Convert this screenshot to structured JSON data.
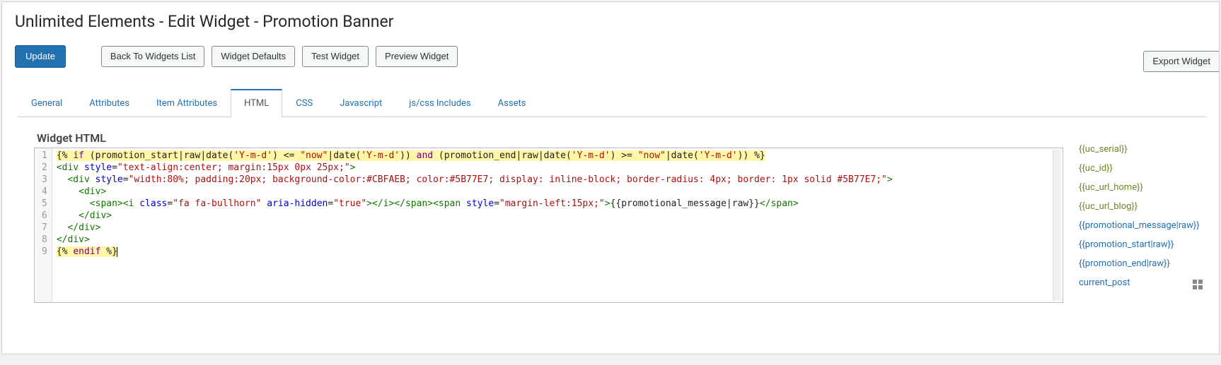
{
  "page": {
    "title": "Unlimited Elements - Edit Widget - Promotion Banner"
  },
  "toolbar": {
    "update": "Update",
    "back": "Back To Widgets List",
    "defaults": "Widget Defaults",
    "test": "Test Widget",
    "preview": "Preview Widget",
    "export": "Export Widget"
  },
  "tabs": [
    {
      "id": "general",
      "label": "General",
      "active": false
    },
    {
      "id": "attributes",
      "label": "Attributes",
      "active": false
    },
    {
      "id": "item-attributes",
      "label": "Item Attributes",
      "active": false
    },
    {
      "id": "html",
      "label": "HTML",
      "active": true
    },
    {
      "id": "css",
      "label": "CSS",
      "active": false
    },
    {
      "id": "js",
      "label": "Javascript",
      "active": false
    },
    {
      "id": "includes",
      "label": "js/css Includes",
      "active": false
    },
    {
      "id": "assets",
      "label": "Assets",
      "active": false
    }
  ],
  "editor": {
    "heading": "Widget HTML",
    "code_lines": [
      {
        "n": 1,
        "hl": true,
        "tokens": [
          {
            "t": "{% ",
            "c": "tok"
          },
          {
            "t": "if",
            "c": "kw"
          },
          {
            "t": " (promotion_start|raw|date(",
            "c": "tok"
          },
          {
            "t": "'Y-m-d'",
            "c": "str"
          },
          {
            "t": ") <= ",
            "c": "tok"
          },
          {
            "t": "\"now\"",
            "c": "str"
          },
          {
            "t": "|date(",
            "c": "tok"
          },
          {
            "t": "'Y-m-d'",
            "c": "str"
          },
          {
            "t": ")) ",
            "c": "tok"
          },
          {
            "t": "and",
            "c": "kw"
          },
          {
            "t": " (promotion_end|raw|date(",
            "c": "tok"
          },
          {
            "t": "'Y-m-d'",
            "c": "str"
          },
          {
            "t": ") >= ",
            "c": "tok"
          },
          {
            "t": "\"now\"",
            "c": "str"
          },
          {
            "t": "|date(",
            "c": "tok"
          },
          {
            "t": "'Y-m-d'",
            "c": "str"
          },
          {
            "t": ")) %}",
            "c": "tok"
          }
        ]
      },
      {
        "n": 2,
        "hl": false,
        "tokens": [
          {
            "t": "<div ",
            "c": "tag"
          },
          {
            "t": "style",
            "c": "attr"
          },
          {
            "t": "=",
            "c": "tok"
          },
          {
            "t": "\"text-align:center; margin:15px 0px 25px;\"",
            "c": "str"
          },
          {
            "t": ">",
            "c": "tag"
          }
        ]
      },
      {
        "n": 3,
        "hl": false,
        "tokens": [
          {
            "t": "  <div ",
            "c": "tag"
          },
          {
            "t": "style",
            "c": "attr"
          },
          {
            "t": "=",
            "c": "tok"
          },
          {
            "t": "\"width:80%; padding:20px; background-color:#CBFAEB; color:#5B77E7; display: inline-block; border-radius: 4px; border: 1px solid #5B77E7;\"",
            "c": "str"
          },
          {
            "t": ">",
            "c": "tag"
          }
        ]
      },
      {
        "n": 4,
        "hl": false,
        "tokens": [
          {
            "t": "    <div>",
            "c": "tag"
          }
        ]
      },
      {
        "n": 5,
        "hl": false,
        "tokens": [
          {
            "t": "      <span><i ",
            "c": "tag"
          },
          {
            "t": "class",
            "c": "attr"
          },
          {
            "t": "=",
            "c": "tok"
          },
          {
            "t": "\"fa fa-bullhorn\"",
            "c": "str"
          },
          {
            "t": " ",
            "c": "tok"
          },
          {
            "t": "aria-hidden",
            "c": "attr"
          },
          {
            "t": "=",
            "c": "tok"
          },
          {
            "t": "\"true\"",
            "c": "str"
          },
          {
            "t": "></i></span><span ",
            "c": "tag"
          },
          {
            "t": "style",
            "c": "attr"
          },
          {
            "t": "=",
            "c": "tok"
          },
          {
            "t": "\"margin-left:15px;\"",
            "c": "str"
          },
          {
            "t": ">",
            "c": "tag"
          },
          {
            "t": "{{promotional_message|raw}}",
            "c": "tok"
          },
          {
            "t": "</span>",
            "c": "tag"
          }
        ]
      },
      {
        "n": 6,
        "hl": false,
        "tokens": [
          {
            "t": "    </div>",
            "c": "tag"
          }
        ]
      },
      {
        "n": 7,
        "hl": false,
        "tokens": [
          {
            "t": "  </div>",
            "c": "tag"
          }
        ]
      },
      {
        "n": 8,
        "hl": false,
        "tokens": [
          {
            "t": "</div>",
            "c": "tag"
          }
        ]
      },
      {
        "n": 9,
        "hl": true,
        "tokens": [
          {
            "t": "{% ",
            "c": "tok"
          },
          {
            "t": "endif",
            "c": "kw"
          },
          {
            "t": " %}",
            "c": "tok"
          }
        ],
        "caret": true
      }
    ]
  },
  "side_vars": [
    {
      "label": "{{uc_serial}}",
      "style": "green"
    },
    {
      "label": "{{uc_id}}",
      "style": "green"
    },
    {
      "label": "{{uc_url_home}}",
      "style": "green"
    },
    {
      "label": "{{uc_url_blog}}",
      "style": "green"
    },
    {
      "label": "{{promotional_message|raw}}",
      "style": "blue"
    },
    {
      "label": "{{promotion_start|raw}}",
      "style": "blue"
    },
    {
      "label": "{{promotion_end|raw}}",
      "style": "blue"
    },
    {
      "label": "current_post",
      "style": "blue",
      "grid": true
    }
  ]
}
